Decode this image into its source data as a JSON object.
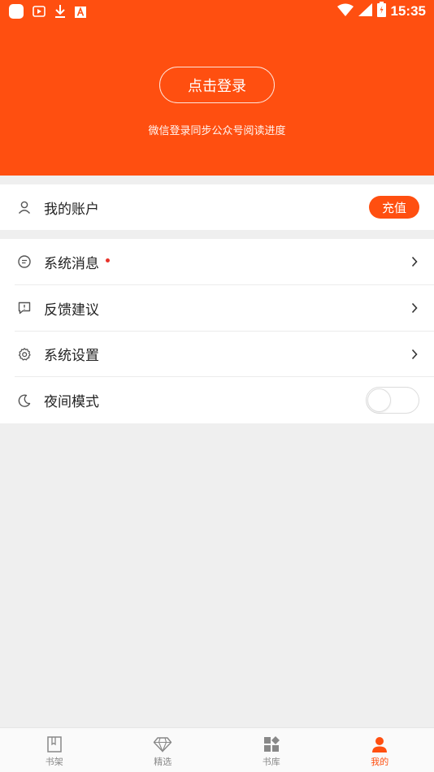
{
  "status_bar": {
    "time": "15:35",
    "left_icons": [
      "app-icon",
      "video-icon",
      "download-icon",
      "a-icon"
    ],
    "right_icons": [
      "wifi-icon",
      "signal-icon",
      "battery-icon"
    ]
  },
  "header": {
    "login_button": "点击登录",
    "hint": "微信登录同步公众号阅读进度",
    "bg_color": "#ff4f10"
  },
  "account": {
    "label": "我的账户",
    "icon": "user-icon",
    "recharge_button": "充值"
  },
  "menu": {
    "items": [
      {
        "label": "系统消息",
        "icon": "message-icon",
        "has_dot": true
      },
      {
        "label": "反馈建议",
        "icon": "feedback-icon"
      },
      {
        "label": "系统设置",
        "icon": "settings-icon"
      },
      {
        "label": "夜间模式",
        "icon": "moon-icon",
        "toggle": false
      }
    ]
  },
  "tabbar": {
    "tabs": [
      {
        "label": "书架",
        "icon": "bookshelf-icon"
      },
      {
        "label": "精选",
        "icon": "diamond-icon"
      },
      {
        "label": "书库",
        "icon": "library-icon"
      },
      {
        "label": "我的",
        "icon": "profile-icon",
        "active": true
      }
    ],
    "active_color": "#ff4f10"
  }
}
